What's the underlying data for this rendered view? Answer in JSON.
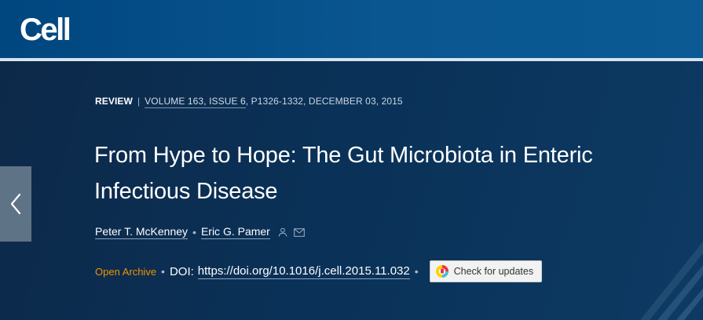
{
  "header": {
    "logo_text": "Cell",
    "colors": {
      "bar": "#00467f",
      "rule": "#d7e3ee"
    }
  },
  "nav": {
    "prev_icon": "chevron-left-icon"
  },
  "article": {
    "type": "REVIEW",
    "separator": "|",
    "volume_issue": "VOLUME 163, ISSUE 6",
    "pages_date": ", P1326-1332, DECEMBER 03, 2015",
    "title": "From Hype to Hope: The Gut Microbiota in Enteric Infectious Disease",
    "authors": [
      {
        "name": "Peter T. McKenney"
      },
      {
        "name": "Eric G. Pamer",
        "icons": [
          "person-icon",
          "mail-icon"
        ]
      }
    ],
    "author_separator": "•",
    "access": "Open Archive",
    "doi_label": "DOI:",
    "doi_url": "https://doi.org/10.1016/j.cell.2015.11.032",
    "check_updates_label": "Check for updates",
    "colors": {
      "access": "#f39200",
      "hero": "#0a3157"
    }
  }
}
